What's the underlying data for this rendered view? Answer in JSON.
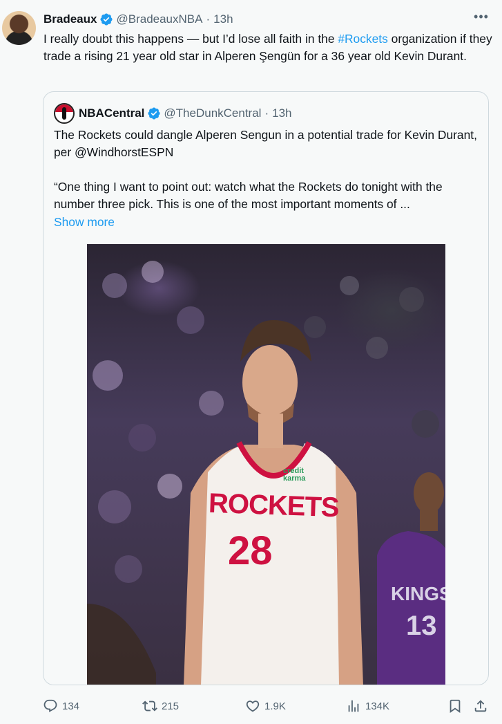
{
  "tweet": {
    "author": {
      "name": "Bradeaux",
      "handle": "@BradeauxNBA",
      "time": "13h"
    },
    "text_before": "I really doubt this happens — but I’d lose all faith in the ",
    "hashtag": "#Rockets",
    "text_after": " organization if they trade a rising 21 year old star in Alperen Şengün for a 36 year old Kevin Durant."
  },
  "quote": {
    "author": {
      "name": "NBACentral",
      "handle": "@TheDunkCentral",
      "time": "13h"
    },
    "paragraph1": "The Rockets could dangle Alperen Sengun in a potential trade for Kevin Durant, per @WindhorstESPN",
    "paragraph2": "“One thing I want to point out: watch what the Rockets do tonight with the number three pick. This is one of the most important moments of ...",
    "show_more": "Show more",
    "photo": {
      "jersey_team": "ROCKETS",
      "jersey_number": "28",
      "jersey_sponsor": "credit karma",
      "opponent_team": "KINGS",
      "opponent_number": "13"
    }
  },
  "actions": {
    "replies": "134",
    "reposts": "215",
    "likes": "1.9K",
    "views": "134K"
  },
  "colors": {
    "accent": "#1d9bf0",
    "text": "#0f1419",
    "muted": "#536471",
    "rockets_red": "#ce1141",
    "kings_purple": "#5a2d81"
  }
}
